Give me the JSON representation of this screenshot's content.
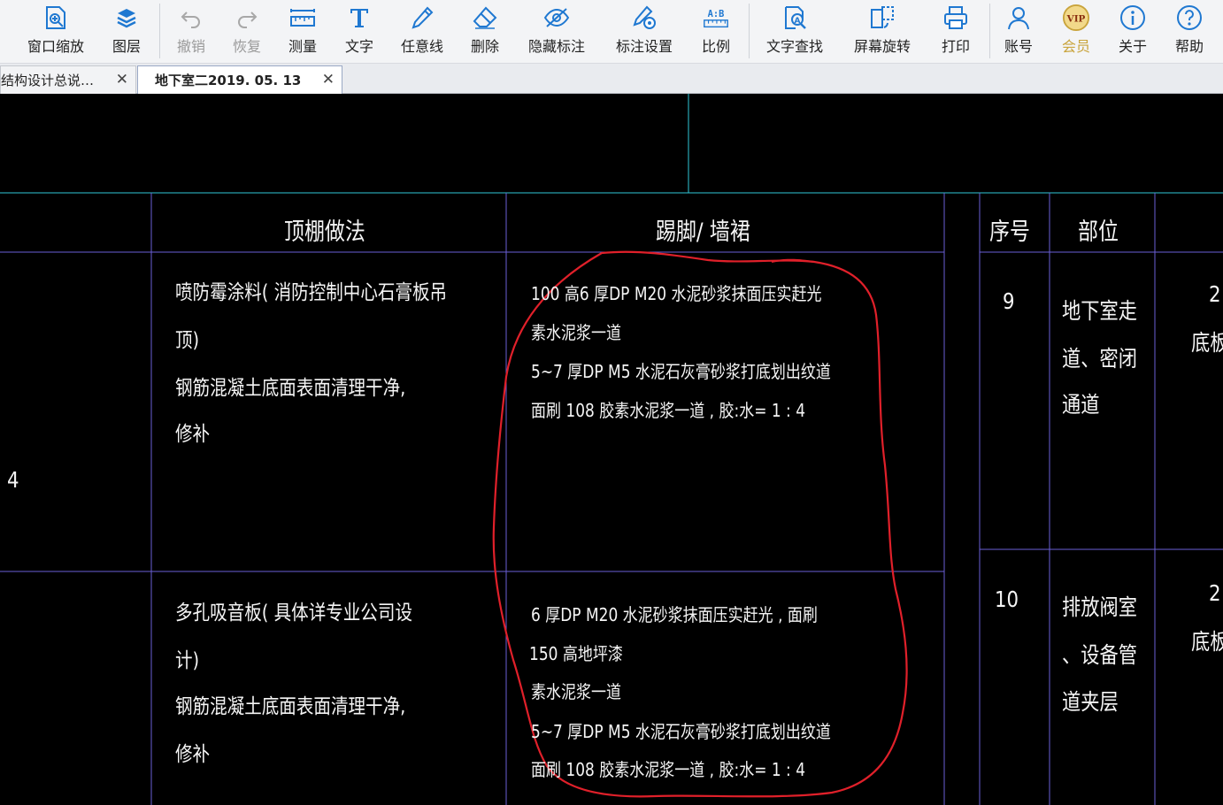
{
  "toolbar": {
    "items": [
      {
        "label": "窗口缩放",
        "icon": "zoom-window-icon"
      },
      {
        "label": "图层",
        "icon": "layers-icon"
      },
      {
        "label": "撤销",
        "icon": "undo-icon"
      },
      {
        "label": "恢复",
        "icon": "redo-icon"
      },
      {
        "label": "测量",
        "icon": "ruler-icon"
      },
      {
        "label": "文字",
        "icon": "text-icon"
      },
      {
        "label": "任意线",
        "icon": "pen-icon"
      },
      {
        "label": "删除",
        "icon": "eraser-icon"
      },
      {
        "label": "隐藏标注",
        "icon": "eye-off-icon"
      },
      {
        "label": "标注设置",
        "icon": "annotation-settings-icon"
      },
      {
        "label": "比例",
        "icon": "scale-ratio-icon"
      },
      {
        "label": "文字查找",
        "icon": "text-search-icon"
      },
      {
        "label": "屏幕旋转",
        "icon": "rotate-screen-icon"
      },
      {
        "label": "打印",
        "icon": "printer-icon"
      },
      {
        "label": "账号",
        "icon": "user-icon"
      },
      {
        "label": "会员",
        "icon": "vip-badge-icon",
        "badge": "VIP"
      },
      {
        "label": "关于",
        "icon": "info-icon"
      },
      {
        "label": "帮助",
        "icon": "help-icon"
      }
    ],
    "scale_icon_text": "A:B"
  },
  "tabs": [
    {
      "label": "结构设计总说…",
      "close": "✕",
      "active": false
    },
    {
      "label": "地下室二2019. 05. 13",
      "close": "✕",
      "active": true
    }
  ],
  "drawing": {
    "headers": {
      "ceiling": "顶棚做法",
      "skirting": "踢脚/ 墙裙",
      "seq": "序号",
      "location": "部位"
    },
    "left_number": "4",
    "row1": {
      "ceiling": [
        "喷防霉涂料( 消防控制中心石膏板吊",
        "顶)",
        "钢筋混凝土底面表面清理干净,",
        "修补"
      ],
      "skirting": [
        "  100   高6 厚DP   M20   水泥砂浆抹面压实赶光",
        "素水泥浆一道",
        "   5~7   厚DP   M5  水泥石灰膏砂浆打底划出纹道",
        "面刷     108   胶素水泥浆一道    , 胶:水=    1 : 4"
      ],
      "seq": "9",
      "location": [
        "地下室走",
        "道、密闭",
        "通道"
      ],
      "right_fragment": [
        "2",
        "底板"
      ]
    },
    "row2": {
      "ceiling": [
        "多孔吸音板( 具体详专业公司设",
        "计)",
        "钢筋混凝土底面表面清理干净,",
        "修补"
      ],
      "skirting": [
        "  6 厚DP   M20   水泥砂浆抹面压实赶光       , 面刷",
        "150   高地坪漆",
        "素水泥浆一道",
        "   5~7   厚DP   M5  水泥石灰膏砂浆打底划出纹道",
        "面刷     108   胶素水泥浆一道    , 胶:水=    1 : 4"
      ],
      "seq": "10",
      "location": [
        "排放阀室",
        "、设备管",
        "道夹层"
      ],
      "right_fragment": [
        "2",
        "底板"
      ]
    },
    "colors": {
      "background": "#000000",
      "text": "#f5f5f5",
      "cyan_line": "#2fc7d8",
      "grid_line": "#6a5fd6",
      "markup": "#e0202a"
    }
  }
}
